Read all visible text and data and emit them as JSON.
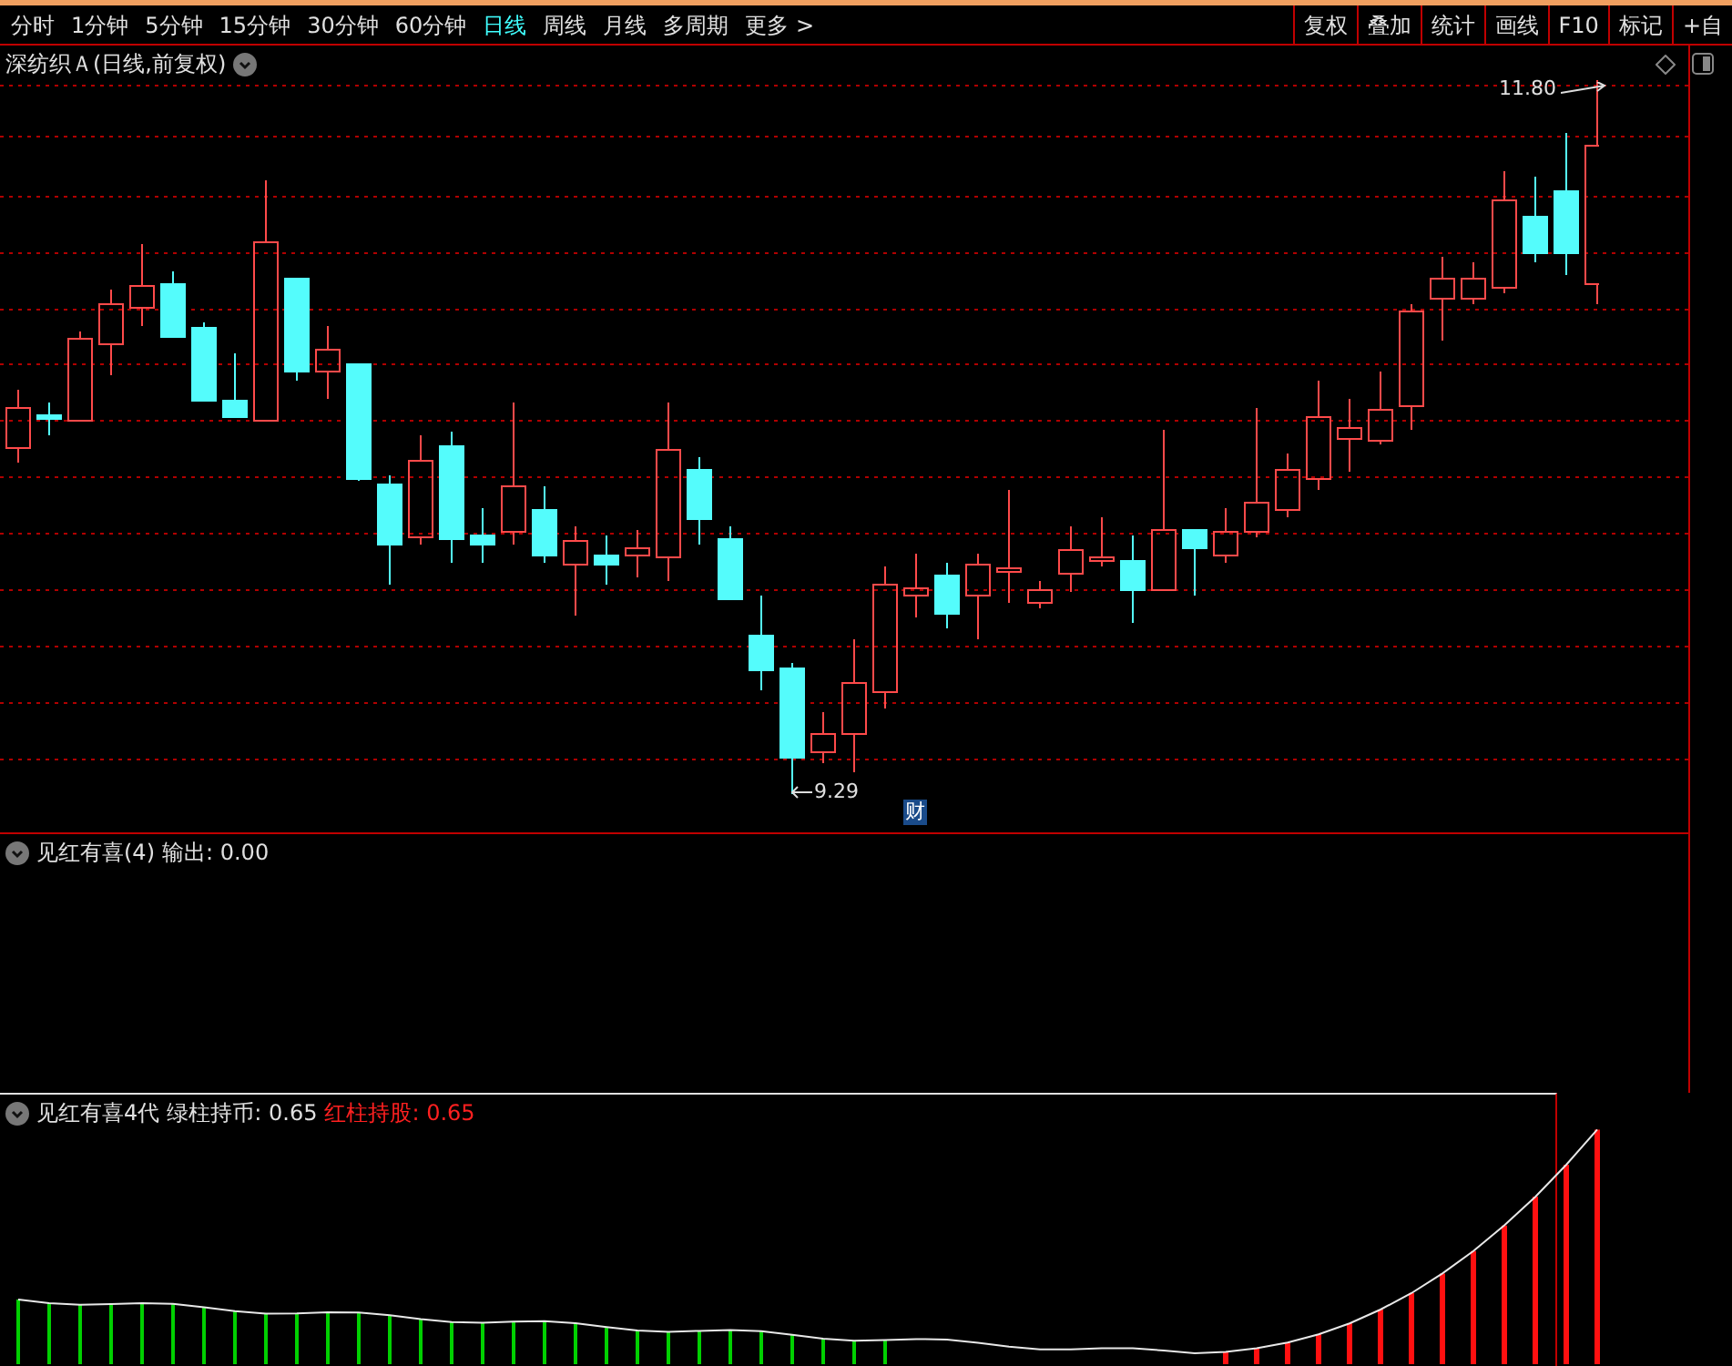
{
  "toolbar": {
    "periods": [
      {
        "label": "分时",
        "selected": false
      },
      {
        "label": "1分钟",
        "selected": false
      },
      {
        "label": "5分钟",
        "selected": false
      },
      {
        "label": "15分钟",
        "selected": false
      },
      {
        "label": "30分钟",
        "selected": false
      },
      {
        "label": "60分钟",
        "selected": false
      },
      {
        "label": "日线",
        "selected": true
      },
      {
        "label": "周线",
        "selected": false
      },
      {
        "label": "月线",
        "selected": false
      },
      {
        "label": "多周期",
        "selected": false
      },
      {
        "label": "更多 >",
        "selected": false
      }
    ],
    "tools": [
      "复权",
      "叠加",
      "统计",
      "画线",
      "F10",
      "标记",
      "+自"
    ]
  },
  "main_chart": {
    "title": "深纺织Ａ(日线,前复权)",
    "high_label": "11.80",
    "low_label": "9.29",
    "marker": "财"
  },
  "indicator_1": {
    "name": "见红有喜(4)",
    "outputs": [
      {
        "label": "输出: 0.00",
        "color": "#e0e0e0"
      }
    ]
  },
  "indicator_2": {
    "name": "见红有喜4代",
    "outputs": [
      {
        "label": "绿柱持币: 0.65",
        "color": "#e0e0e0"
      },
      {
        "label": "红柱持股: 0.65",
        "color": "#ff2020"
      }
    ]
  }
}
